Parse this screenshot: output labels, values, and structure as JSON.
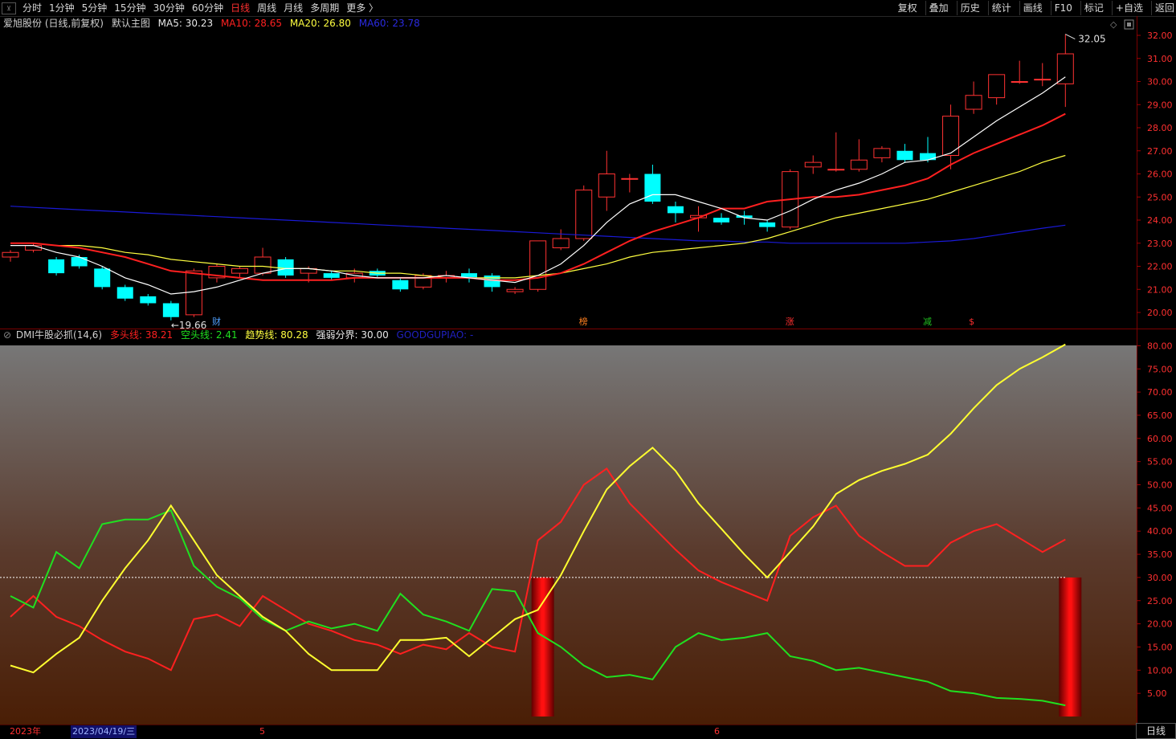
{
  "toolbar": {
    "tabs": [
      "分时",
      "1分钟",
      "5分钟",
      "15分钟",
      "30分钟",
      "60分钟",
      "日线",
      "周线",
      "月线",
      "多周期",
      "更多 〉"
    ],
    "active_tab": 6,
    "right": [
      "复权",
      "叠加",
      "历史",
      "统计",
      "画线",
      "F10",
      "标记",
      "+自选",
      "返回"
    ]
  },
  "main_info": {
    "stock": "爱旭股份 (日线,前复权)",
    "template": "默认主图",
    "ma5_label": "MA5:",
    "ma5_value": "30.23",
    "ma10_label": "MA10:",
    "ma10_value": "28.65",
    "ma20_label": "MA20:",
    "ma20_value": "26.80",
    "ma60_label": "MA60:",
    "ma60_value": "23.78"
  },
  "indicator_info": {
    "name": "DMI牛股必抓(14,6)",
    "long_label": "多头线:",
    "long_value": "38.21",
    "short_label": "空头线:",
    "short_value": "2.41",
    "trend_label": "趋势线:",
    "trend_value": "80.28",
    "boundary_label": "强弱分界:",
    "boundary_value": "30.00",
    "extra_label": "GOODGUPIAO:",
    "extra_value": "-"
  },
  "colors": {
    "up": "#ff3232",
    "down": "#00ffff",
    "ma5": "#ffffff",
    "ma10": "#ff2020",
    "ma20": "#ffff40",
    "ma60": "#1a1ad8",
    "long": "#ff2020",
    "short": "#20e020",
    "trend": "#ffff30",
    "axis_text": "#ff3030"
  },
  "chart_data": [
    {
      "type": "candlestick",
      "y_ticks": [
        "32.00",
        "31.00",
        "30.00",
        "29.00",
        "28.00",
        "27.00",
        "26.00",
        "25.00",
        "24.00",
        "23.00",
        "22.00",
        "21.00",
        "20.00"
      ],
      "ylim": [
        19.9,
        32.2
      ],
      "high_label": "32.05",
      "low_label": "←19.66",
      "markers": [
        "财",
        "榜",
        "涨",
        "减",
        "$"
      ],
      "candles": [
        [
          22.4,
          22.6,
          22.2,
          22.7
        ],
        [
          22.7,
          22.9,
          22.6,
          23.0
        ],
        [
          22.3,
          21.7,
          21.6,
          22.4
        ],
        [
          22.4,
          22.0,
          21.9,
          22.5
        ],
        [
          21.9,
          21.1,
          21.0,
          22.0
        ],
        [
          21.1,
          20.6,
          20.5,
          21.2
        ],
        [
          20.7,
          20.4,
          20.3,
          20.8
        ],
        [
          20.4,
          19.8,
          19.66,
          20.5
        ],
        [
          19.9,
          21.8,
          19.8,
          21.9
        ],
        [
          21.5,
          22.0,
          21.3,
          22.1
        ],
        [
          21.7,
          21.9,
          21.5,
          22.0
        ],
        [
          21.7,
          22.4,
          21.6,
          22.8
        ],
        [
          22.3,
          21.6,
          21.5,
          22.4
        ],
        [
          21.7,
          21.9,
          21.3,
          22.0
        ],
        [
          21.7,
          21.5,
          21.4,
          21.8
        ],
        [
          21.5,
          21.7,
          21.3,
          21.9
        ],
        [
          21.8,
          21.6,
          21.5,
          21.9
        ],
        [
          21.4,
          21.0,
          20.9,
          21.5
        ],
        [
          21.1,
          21.6,
          21.0,
          21.7
        ],
        [
          21.5,
          21.6,
          21.3,
          21.8
        ],
        [
          21.7,
          21.5,
          21.3,
          21.9
        ],
        [
          21.6,
          21.1,
          20.9,
          21.7
        ],
        [
          20.9,
          21.0,
          20.8,
          21.1
        ],
        [
          21.0,
          23.1,
          20.9,
          23.1
        ],
        [
          22.8,
          23.2,
          22.7,
          23.6
        ],
        [
          23.2,
          25.3,
          23.1,
          25.5
        ],
        [
          25.0,
          26.0,
          24.4,
          27.0
        ],
        [
          25.8,
          25.8,
          25.2,
          26.0
        ],
        [
          26.0,
          24.8,
          24.7,
          26.4
        ],
        [
          24.6,
          24.3,
          23.9,
          24.8
        ],
        [
          24.1,
          24.2,
          23.5,
          24.6
        ],
        [
          24.1,
          23.9,
          23.8,
          24.3
        ],
        [
          24.2,
          24.1,
          23.8,
          24.4
        ],
        [
          23.9,
          23.7,
          23.5,
          24.0
        ],
        [
          23.7,
          26.1,
          23.6,
          26.2
        ],
        [
          26.3,
          26.5,
          26.0,
          26.8
        ],
        [
          26.2,
          26.2,
          26.1,
          27.8
        ],
        [
          26.2,
          26.6,
          26.1,
          27.5
        ],
        [
          26.7,
          27.1,
          26.5,
          27.2
        ],
        [
          27.0,
          26.6,
          26.5,
          27.3
        ],
        [
          26.9,
          26.6,
          26.5,
          27.6
        ],
        [
          26.8,
          28.5,
          26.2,
          29.0
        ],
        [
          28.8,
          29.4,
          28.6,
          30.0
        ],
        [
          29.3,
          30.3,
          29.0,
          30.3
        ],
        [
          30.0,
          30.0,
          29.9,
          30.9
        ],
        [
          30.1,
          30.1,
          29.8,
          30.8
        ],
        [
          29.9,
          31.2,
          28.9,
          32.05
        ]
      ],
      "ma5": [
        22.9,
        22.9,
        22.6,
        22.4,
        22.0,
        21.5,
        21.2,
        20.8,
        20.9,
        21.1,
        21.4,
        21.7,
        21.9,
        21.9,
        21.8,
        21.6,
        21.5,
        21.5,
        21.5,
        21.6,
        21.5,
        21.4,
        21.3,
        21.6,
        22.1,
        22.9,
        23.9,
        24.7,
        25.1,
        25.1,
        24.8,
        24.5,
        24.1,
        24.0,
        24.4,
        24.9,
        25.3,
        25.6,
        26.0,
        26.5,
        26.6,
        26.9,
        27.6,
        28.3,
        28.9,
        29.5,
        30.2
      ],
      "ma10": [
        23.0,
        23.0,
        22.9,
        22.8,
        22.6,
        22.4,
        22.1,
        21.8,
        21.7,
        21.6,
        21.5,
        21.4,
        21.4,
        21.4,
        21.4,
        21.5,
        21.5,
        21.5,
        21.5,
        21.5,
        21.5,
        21.4,
        21.4,
        21.5,
        21.7,
        22.1,
        22.6,
        23.1,
        23.5,
        23.8,
        24.1,
        24.5,
        24.5,
        24.8,
        24.9,
        25.0,
        25.0,
        25.1,
        25.3,
        25.5,
        25.8,
        26.4,
        26.9,
        27.3,
        27.7,
        28.1,
        28.6
      ],
      "ma20": [
        23.0,
        23.0,
        22.9,
        22.9,
        22.8,
        22.6,
        22.5,
        22.3,
        22.2,
        22.1,
        22.0,
        22.0,
        21.9,
        21.9,
        21.8,
        21.8,
        21.7,
        21.7,
        21.6,
        21.5,
        21.5,
        21.5,
        21.5,
        21.6,
        21.7,
        21.9,
        22.1,
        22.4,
        22.6,
        22.7,
        22.8,
        22.9,
        23.0,
        23.2,
        23.5,
        23.8,
        24.1,
        24.3,
        24.5,
        24.7,
        24.9,
        25.2,
        25.5,
        25.8,
        26.1,
        26.5,
        26.8
      ],
      "ma60": [
        24.6,
        24.55,
        24.5,
        24.45,
        24.4,
        24.35,
        24.3,
        24.25,
        24.2,
        24.15,
        24.1,
        24.05,
        24.0,
        23.95,
        23.9,
        23.85,
        23.8,
        23.75,
        23.7,
        23.65,
        23.6,
        23.55,
        23.5,
        23.45,
        23.4,
        23.35,
        23.3,
        23.25,
        23.2,
        23.15,
        23.1,
        23.1,
        23.05,
        23.05,
        23.0,
        23.0,
        23.0,
        23.0,
        23.0,
        23.0,
        23.05,
        23.1,
        23.2,
        23.35,
        23.5,
        23.65,
        23.78
      ]
    },
    {
      "type": "line",
      "y_ticks": [
        "80.00",
        "75.00",
        "70.00",
        "65.00",
        "60.00",
        "55.00",
        "50.00",
        "45.00",
        "40.00",
        "35.00",
        "30.00",
        "25.00",
        "20.00",
        "15.00",
        "10.00",
        "5.00"
      ],
      "ylim": [
        0,
        81
      ],
      "threshold": 30,
      "signal_bars_at": [
        23,
        46
      ],
      "series": [
        {
          "name": "多头线",
          "values": [
            21.5,
            26,
            21.5,
            19.5,
            16.5,
            14,
            12.5,
            10,
            21,
            22,
            19.5,
            26,
            23,
            20,
            18.5,
            16.5,
            15.5,
            13.5,
            15.5,
            14.5,
            18,
            15,
            14,
            38,
            42,
            50,
            53.5,
            46,
            41,
            36,
            31.5,
            29,
            27,
            25,
            39,
            43,
            45.5,
            39,
            35.5,
            32.5,
            32.5,
            37.5,
            40,
            41.5,
            38.5,
            35.5,
            38.2
          ]
        },
        {
          "name": "空头线",
          "values": [
            26,
            23.5,
            35.5,
            32,
            41.5,
            42.5,
            42.5,
            44.5,
            32.5,
            28,
            25.5,
            21,
            18.5,
            20.5,
            19,
            20,
            18.5,
            26.5,
            22,
            20.5,
            18.5,
            27.5,
            27,
            18,
            15,
            11,
            8.5,
            9,
            8,
            15,
            18,
            16.5,
            17,
            18,
            13,
            12,
            10,
            10.5,
            9.5,
            8.5,
            7.5,
            5.5,
            5,
            4,
            3.8,
            3.4,
            2.41
          ]
        },
        {
          "name": "趋势线",
          "values": [
            11,
            9.5,
            13.5,
            17,
            25,
            32,
            38,
            45.5,
            38,
            30.5,
            26,
            21.5,
            18.5,
            13.5,
            10,
            10,
            10,
            16.5,
            16.5,
            17,
            13,
            17,
            21,
            23,
            30.5,
            40,
            49,
            54,
            58,
            53,
            46,
            40.5,
            35,
            30,
            35.5,
            41,
            48,
            51,
            53,
            54.5,
            56.5,
            61,
            66.5,
            71.5,
            75,
            77.5,
            80.3
          ]
        }
      ]
    }
  ],
  "bottom": {
    "year": "2023年",
    "selected_date": "2023/04/19/三",
    "month_5": "5",
    "month_6": "6",
    "period": "日线"
  }
}
